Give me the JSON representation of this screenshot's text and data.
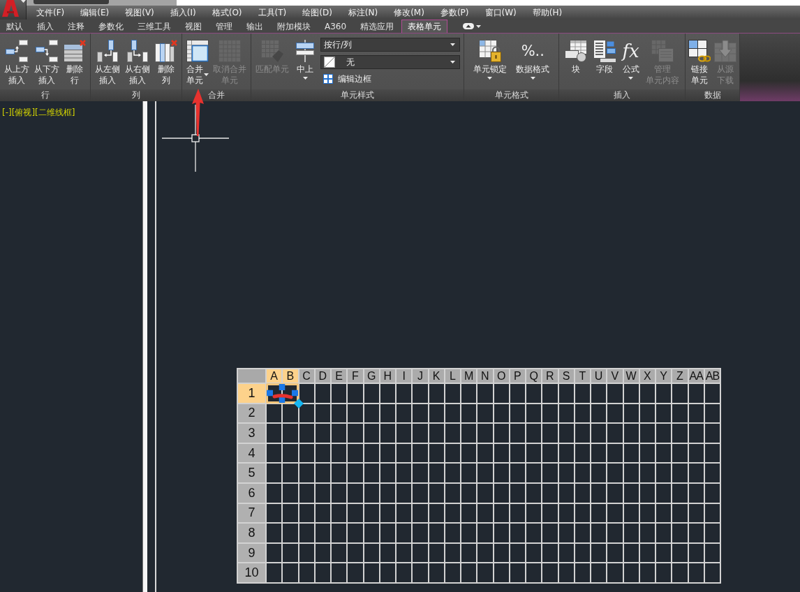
{
  "menu_bar": [
    "文件(F)",
    "编辑(E)",
    "视图(V)",
    "插入(I)",
    "格式(O)",
    "工具(T)",
    "绘图(D)",
    "标注(N)",
    "修改(M)",
    "参数(P)",
    "窗口(W)",
    "帮助(H)"
  ],
  "ribbon_tabs": [
    {
      "label": "默认",
      "selected": false
    },
    {
      "label": "插入",
      "selected": false
    },
    {
      "label": "注释",
      "selected": false
    },
    {
      "label": "参数化",
      "selected": false
    },
    {
      "label": "三维工具",
      "selected": false
    },
    {
      "label": "视图",
      "selected": false
    },
    {
      "label": "管理",
      "selected": false
    },
    {
      "label": "输出",
      "selected": false
    },
    {
      "label": "附加模块",
      "selected": false
    },
    {
      "label": "A360",
      "selected": false
    },
    {
      "label": "精选应用",
      "selected": false
    },
    {
      "label": "表格单元",
      "selected": true
    }
  ],
  "ribbon_panels": [
    {
      "title": "行",
      "items": [
        {
          "kind": "large",
          "lines": [
            "从上方",
            "插入"
          ],
          "disabled": false,
          "dropdown": false
        },
        {
          "kind": "large",
          "lines": [
            "从下方",
            "插入"
          ],
          "disabled": false,
          "dropdown": false
        },
        {
          "kind": "large",
          "lines": [
            "删除",
            "行"
          ],
          "disabled": false,
          "dropdown": false
        }
      ]
    },
    {
      "title": "列",
      "items": [
        {
          "kind": "large",
          "lines": [
            "从左侧",
            "插入"
          ],
          "disabled": false,
          "dropdown": false
        },
        {
          "kind": "large",
          "lines": [
            "从右侧",
            "插入"
          ],
          "disabled": false,
          "dropdown": false
        },
        {
          "kind": "large",
          "lines": [
            "删除",
            "列"
          ],
          "disabled": false,
          "dropdown": false
        }
      ]
    },
    {
      "title": "合并",
      "items": [
        {
          "kind": "large",
          "lines": [
            "合并",
            "单元"
          ],
          "disabled": false,
          "dropdown": true
        },
        {
          "kind": "large",
          "lines": [
            "取消合并",
            "单元"
          ],
          "disabled": true,
          "dropdown": false
        }
      ]
    },
    {
      "title": "单元样式",
      "items": [
        {
          "kind": "large",
          "lines": [
            "匹配单元"
          ],
          "disabled": true,
          "dropdown": false
        },
        {
          "kind": "large",
          "lines": [
            "中上"
          ],
          "disabled": false,
          "dropdown": true
        },
        {
          "kind": "stack",
          "items": [
            {
              "kind": "combo",
              "value": "按行/列",
              "swatch": false
            },
            {
              "kind": "combo",
              "value": "无",
              "swatch": true
            },
            {
              "kind": "small",
              "label": "编辑边框"
            }
          ]
        }
      ]
    },
    {
      "title": "单元格式",
      "items": [
        {
          "kind": "large",
          "lines": [
            "单元锁定"
          ],
          "disabled": false,
          "dropdown": true
        },
        {
          "kind": "large",
          "glyph": {
            "text": "%..",
            "italic": false
          },
          "lines": [
            "数据格式"
          ],
          "disabled": false,
          "dropdown": true
        }
      ]
    },
    {
      "title": "插入",
      "items": [
        {
          "kind": "large",
          "lines": [
            "块"
          ],
          "disabled": false,
          "dropdown": false
        },
        {
          "kind": "large",
          "lines": [
            "字段"
          ],
          "disabled": false,
          "dropdown": false
        },
        {
          "kind": "large",
          "glyph": {
            "text": "fx",
            "italic": true
          },
          "lines": [
            "公式"
          ],
          "disabled": false,
          "dropdown": true
        },
        {
          "kind": "large",
          "lines": [
            "管理",
            "单元内容"
          ],
          "disabled": true,
          "dropdown": false
        }
      ]
    },
    {
      "title": "数据",
      "items": [
        {
          "kind": "large",
          "lines": [
            "链接",
            "单元"
          ],
          "disabled": false,
          "dropdown": false
        },
        {
          "kind": "large",
          "lines": [
            "从源",
            "下载"
          ],
          "disabled": true,
          "dropdown": false
        }
      ]
    }
  ],
  "viewport_label": "[-][俯视][二维线框]",
  "table": {
    "columns": [
      {
        "label": "A",
        "selected": true
      },
      {
        "label": "B",
        "selected": true
      },
      {
        "label": "C",
        "selected": false
      },
      {
        "label": "D",
        "selected": false
      },
      {
        "label": "E",
        "selected": false
      },
      {
        "label": "F",
        "selected": false
      },
      {
        "label": "G",
        "selected": false
      },
      {
        "label": "H",
        "selected": false
      },
      {
        "label": "I",
        "selected": false
      },
      {
        "label": "J",
        "selected": false
      },
      {
        "label": "K",
        "selected": false
      },
      {
        "label": "L",
        "selected": false
      },
      {
        "label": "M",
        "selected": false
      },
      {
        "label": "N",
        "selected": false
      },
      {
        "label": "O",
        "selected": false
      },
      {
        "label": "P",
        "selected": false
      },
      {
        "label": "Q",
        "selected": false
      },
      {
        "label": "R",
        "selected": false
      },
      {
        "label": "S",
        "selected": false
      },
      {
        "label": "T",
        "selected": false
      },
      {
        "label": "U",
        "selected": false
      },
      {
        "label": "V",
        "selected": false
      },
      {
        "label": "W",
        "selected": false
      },
      {
        "label": "X",
        "selected": false
      },
      {
        "label": "Y",
        "selected": false
      },
      {
        "label": "Z",
        "selected": false
      },
      {
        "label": "AA",
        "selected": false
      },
      {
        "label": "AB",
        "selected": false
      }
    ],
    "rows": [
      {
        "label": "1",
        "selected": true
      },
      {
        "label": "2",
        "selected": false
      },
      {
        "label": "3",
        "selected": false
      },
      {
        "label": "4",
        "selected": false
      },
      {
        "label": "5",
        "selected": false
      },
      {
        "label": "6",
        "selected": false
      },
      {
        "label": "7",
        "selected": false
      },
      {
        "label": "8",
        "selected": false
      },
      {
        "label": "9",
        "selected": false
      },
      {
        "label": "10",
        "selected": false
      }
    ]
  }
}
